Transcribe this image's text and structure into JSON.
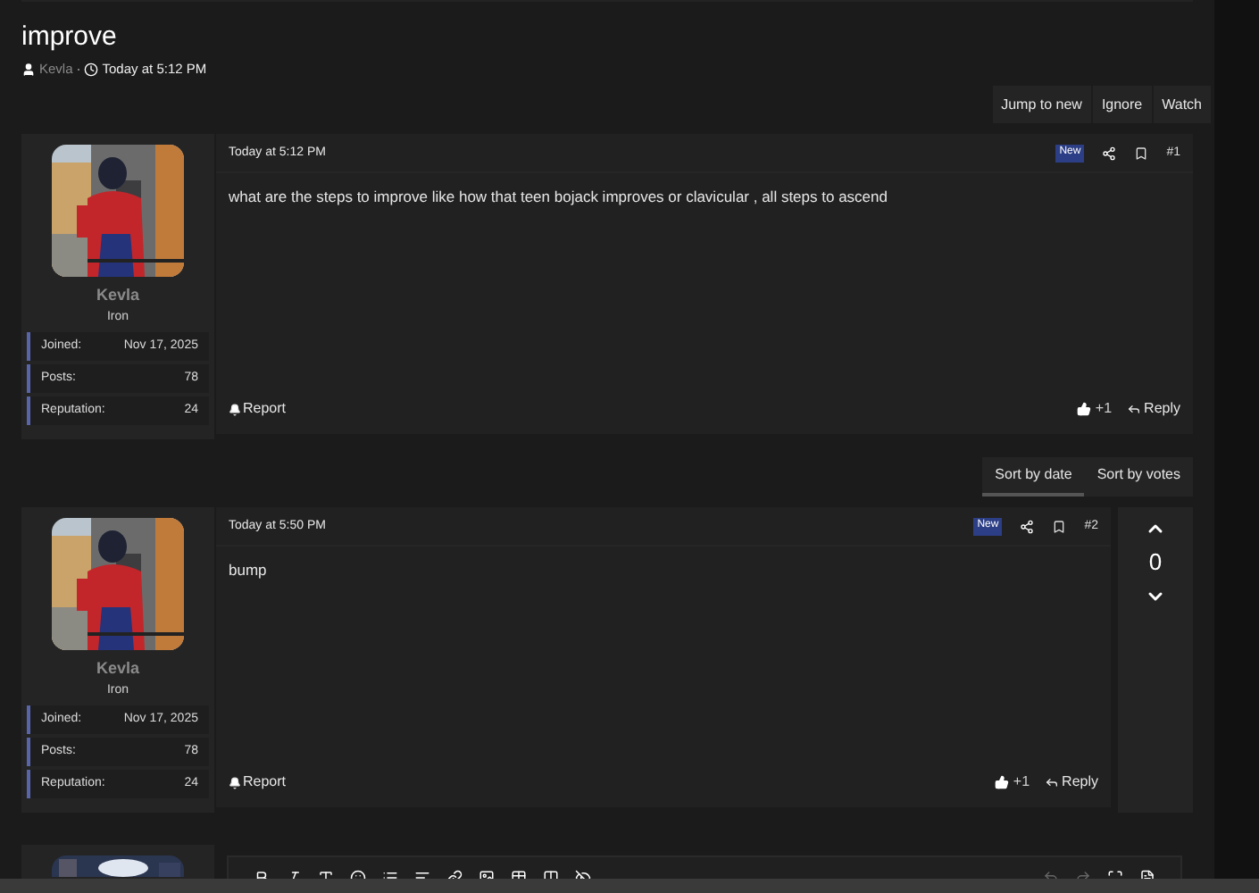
{
  "thread": {
    "title": "improve",
    "author": "Kevla",
    "separator": "·",
    "time": "Today at 5:12 PM"
  },
  "actions": [
    "Jump to new",
    "Ignore",
    "Watch"
  ],
  "sort_tabs": [
    {
      "label": "Sort by date",
      "selected": true
    },
    {
      "label": "Sort by votes",
      "selected": false
    }
  ],
  "posts": [
    {
      "user": {
        "name": "Kevla",
        "rank": "Iron",
        "stats": [
          {
            "label": "Joined:",
            "value": "Nov 17, 2025"
          },
          {
            "label": "Posts:",
            "value": "78"
          },
          {
            "label": "Reputation:",
            "value": "24"
          }
        ]
      },
      "date": "Today at 5:12 PM",
      "badge": "New",
      "number": "#1",
      "body": "what are the steps to improve like how that teen bojack improves or clavicular , all steps to ascend",
      "report": "Report",
      "like": "+1",
      "reply": "Reply"
    },
    {
      "user": {
        "name": "Kevla",
        "rank": "Iron",
        "stats": [
          {
            "label": "Joined:",
            "value": "Nov 17, 2025"
          },
          {
            "label": "Posts:",
            "value": "78"
          },
          {
            "label": "Reputation:",
            "value": "24"
          }
        ]
      },
      "date": "Today at 5:50 PM",
      "badge": "New",
      "number": "#2",
      "body": "bump",
      "report": "Report",
      "like": "+1",
      "reply": "Reply",
      "vote_score": "0"
    }
  ]
}
